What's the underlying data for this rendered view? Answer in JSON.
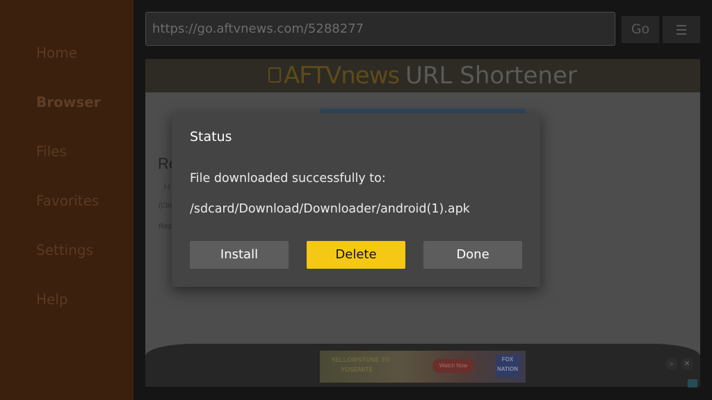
{
  "sidebar": {
    "items": [
      {
        "label": "Home"
      },
      {
        "label": "Browser",
        "active": true
      },
      {
        "label": "Files"
      },
      {
        "label": "Favorites"
      },
      {
        "label": "Settings"
      },
      {
        "label": "Help"
      }
    ]
  },
  "toolbar": {
    "url": "https://go.aftvnews.com/5288277",
    "go_label": "Go",
    "menu_icon": "hamburger-menu-icon"
  },
  "webpage": {
    "logo_brand": "AFTVnews",
    "logo_title": "URL Shortener",
    "faded_heading": "Re",
    "faded_sub": "H",
    "faded_note1": "(Clic",
    "faded_note2": "Red",
    "ad_bottom": {
      "line1": "YELLOWSTONE TO",
      "line2": "YOSEMITE",
      "cta": "Watch Now",
      "logo": "FOX NATION"
    }
  },
  "dialog": {
    "title": "Status",
    "message": "File downloaded successfully to:",
    "path": "/sdcard/Download/Downloader/android(1).apk",
    "buttons": {
      "install": "Install",
      "delete": "Delete",
      "done": "Done"
    },
    "focused_button": "Delete",
    "accent_color": "#f4c814"
  }
}
